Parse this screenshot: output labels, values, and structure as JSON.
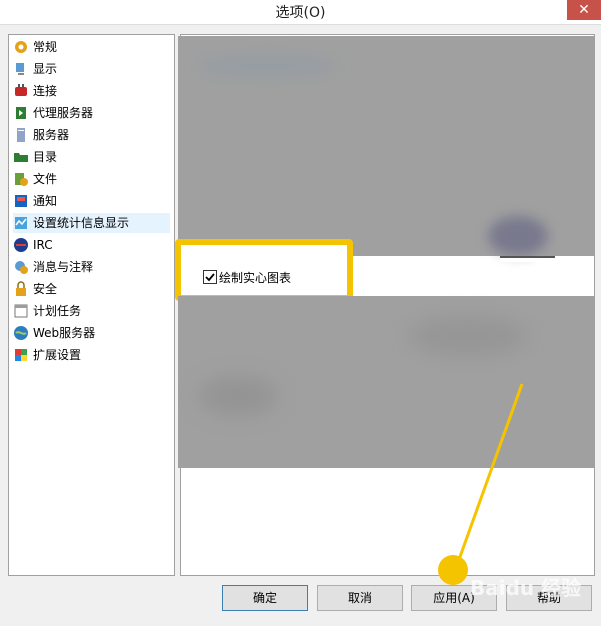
{
  "window": {
    "title": "选项(O)",
    "close_glyph": "✕"
  },
  "sidebar": {
    "items": [
      {
        "label": "常规",
        "icon": "gear-icon"
      },
      {
        "label": "显示",
        "icon": "monitor-icon"
      },
      {
        "label": "连接",
        "icon": "plug-icon"
      },
      {
        "label": "代理服务器",
        "icon": "proxy-icon"
      },
      {
        "label": "服务器",
        "icon": "server-icon"
      },
      {
        "label": "目录",
        "icon": "folder-icon"
      },
      {
        "label": "文件",
        "icon": "file-icon"
      },
      {
        "label": "通知",
        "icon": "notify-icon"
      },
      {
        "label": "设置统计信息显示",
        "icon": "stats-icon",
        "selected": true
      },
      {
        "label": "IRC",
        "icon": "irc-icon"
      },
      {
        "label": "消息与注释",
        "icon": "messages-icon"
      },
      {
        "label": "安全",
        "icon": "lock-icon"
      },
      {
        "label": "计划任务",
        "icon": "calendar-icon"
      },
      {
        "label": "Web服务器",
        "icon": "globe-icon"
      },
      {
        "label": "扩展设置",
        "icon": "extensions-icon"
      }
    ]
  },
  "settings": {
    "draw_solid_chart_label": "绘制实心图表",
    "draw_solid_chart_checked": true
  },
  "buttons": {
    "ok": "确定",
    "cancel": "取消",
    "apply": "应用(A)",
    "help": "帮助"
  },
  "watermark": "Baidu 经验",
  "colors": {
    "highlight": "#f5c400",
    "selection": "#e5f3ff",
    "close": "#c7524a"
  }
}
